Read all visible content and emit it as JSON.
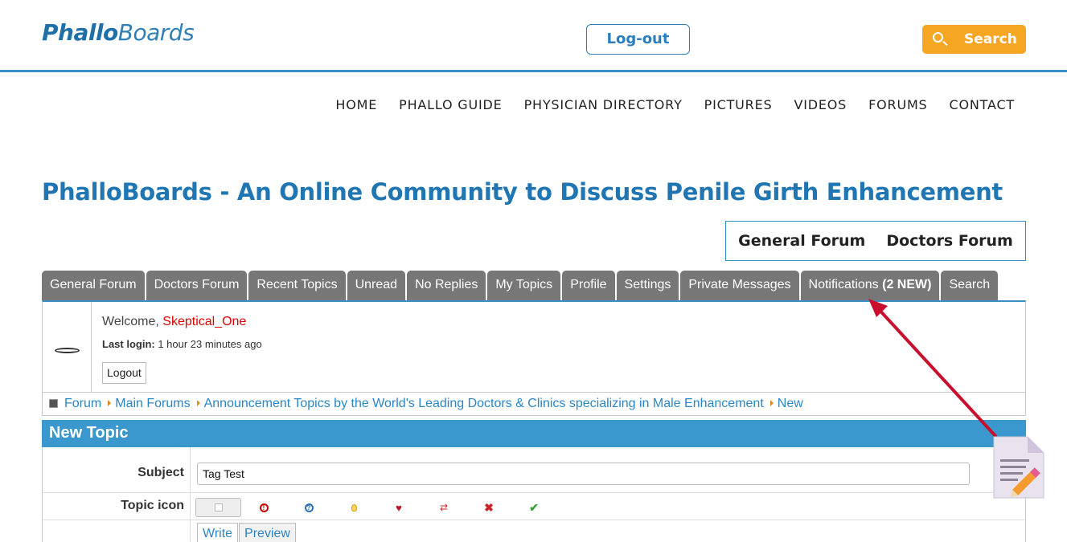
{
  "header": {
    "logo_bold": "Phallo",
    "logo_light": "Boards",
    "logout_label": "Log-out",
    "search_label": "Search"
  },
  "nav": {
    "items": [
      {
        "label": "HOME"
      },
      {
        "label": "PHALLO GUIDE"
      },
      {
        "label": "PHYSICIAN DIRECTORY"
      },
      {
        "label": "PICTURES"
      },
      {
        "label": "VIDEOS"
      },
      {
        "label": "FORUMS"
      },
      {
        "label": "CONTACT"
      }
    ]
  },
  "site_title": "PhalloBoards - An Online Community to Discuss Penile Girth Enhancement",
  "forum_switch": {
    "general": "General Forum",
    "doctors": "Doctors Forum"
  },
  "tabs": {
    "general": "General Forum",
    "doctors": "Doctors Forum",
    "recent": "Recent Topics",
    "unread": "Unread",
    "noreplies": "No Replies",
    "mytopics": "My Topics",
    "profile": "Profile",
    "settings": "Settings",
    "pm": "Private Messages",
    "notif_label": "Notifications ",
    "notif_count": "(2 NEW)",
    "search": "Search"
  },
  "user": {
    "welcome_prefix": "Welcome, ",
    "username": "Skeptical_One",
    "last_login_label": "Last login:",
    "last_login_value": " 1 hour 23 minutes ago",
    "logout_label": "Logout"
  },
  "breadcrumb": {
    "items": [
      "Forum",
      "Main Forums",
      "Announcement Topics by the World's Leading Doctors & Clinics specializing in Male Enhancement",
      "New"
    ]
  },
  "new_topic": {
    "title": "New Topic",
    "subject_label": "Subject",
    "subject_value": "Tag Test",
    "topic_icon_label": "Topic icon",
    "write_tab": "Write",
    "preview_tab": "Preview"
  },
  "colors": {
    "accent": "#3a98ce",
    "brand": "#1f76b3",
    "search": "#f5a623",
    "tab": "#777777",
    "annotation": "#c8102e"
  }
}
